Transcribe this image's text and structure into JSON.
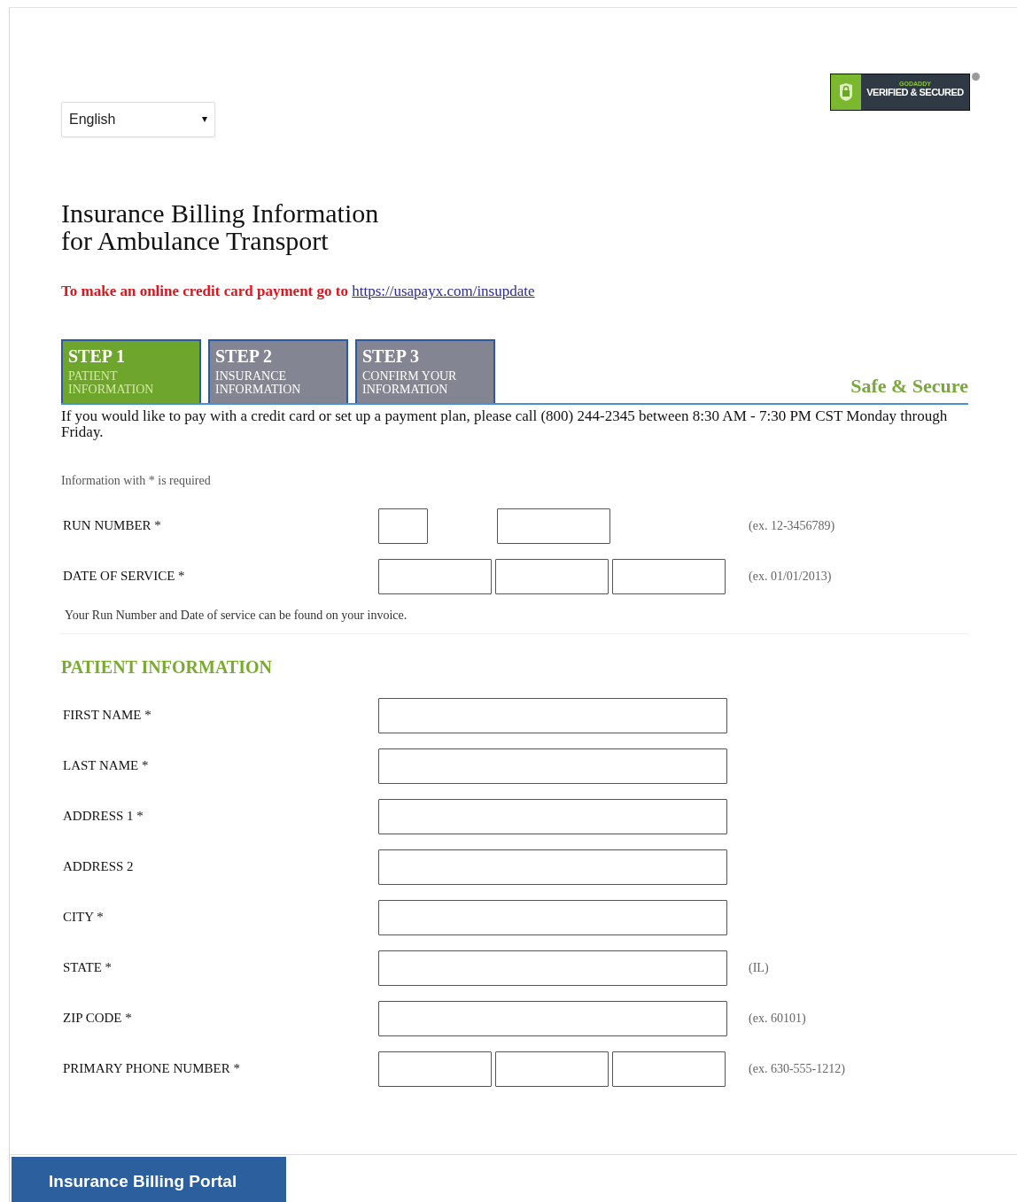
{
  "badge": {
    "brand": "GODADDY",
    "text": "VERIFIED & SECURED"
  },
  "language": {
    "value": "English"
  },
  "title": [
    "Insurance Billing Information",
    "for Ambulance Transport"
  ],
  "payment_notice": {
    "text": "To make an online credit card payment go to",
    "link": "https://usapayx.com/insupdate"
  },
  "steps": [
    {
      "step": "STEP 1",
      "label": [
        "PATIENT",
        "INFORMATION"
      ],
      "selected": true
    },
    {
      "step": "STEP 2",
      "label": [
        "INSURANCE",
        "INFORMATION"
      ],
      "selected": false
    },
    {
      "step": "STEP 3",
      "label": [
        "CONFIRM YOUR",
        "INFORMATION"
      ],
      "selected": false
    }
  ],
  "safe_label": "Safe & Secure",
  "intro": "If you would like to pay with a credit card or set up a payment plan, please call (800) 244-2345 between 8:30 AM - 7:30 PM CST Monday through Friday.",
  "required_note": "Information with * is required",
  "invoice_fields": [
    {
      "label": "RUN NUMBER *",
      "kind": "run",
      "hint": "(ex. 12-3456789)"
    },
    {
      "label": "DATE OF SERVICE *",
      "kind": "triple",
      "hint": "(ex. 01/01/2013)"
    }
  ],
  "invoice_note": "Your Run Number and Date of service can be found on your invoice.",
  "section_heading": "PATIENT INFORMATION",
  "patient_fields": [
    {
      "label": "FIRST NAME *",
      "kind": "single"
    },
    {
      "label": "LAST NAME *",
      "kind": "single"
    },
    {
      "label": "ADDRESS 1 *",
      "kind": "single"
    },
    {
      "label": "ADDRESS 2",
      "kind": "single"
    },
    {
      "label": "CITY *",
      "kind": "single"
    },
    {
      "label": "STATE *",
      "kind": "single",
      "hint": "(IL)"
    },
    {
      "label": "ZIP CODE *",
      "kind": "single",
      "hint": "(ex. 60101)"
    },
    {
      "label": "PRIMARY PHONE NUMBER *",
      "kind": "triple",
      "hint": "(ex. 630-555-1212)"
    }
  ],
  "footer": {
    "title": "Insurance Billing Portal"
  }
}
